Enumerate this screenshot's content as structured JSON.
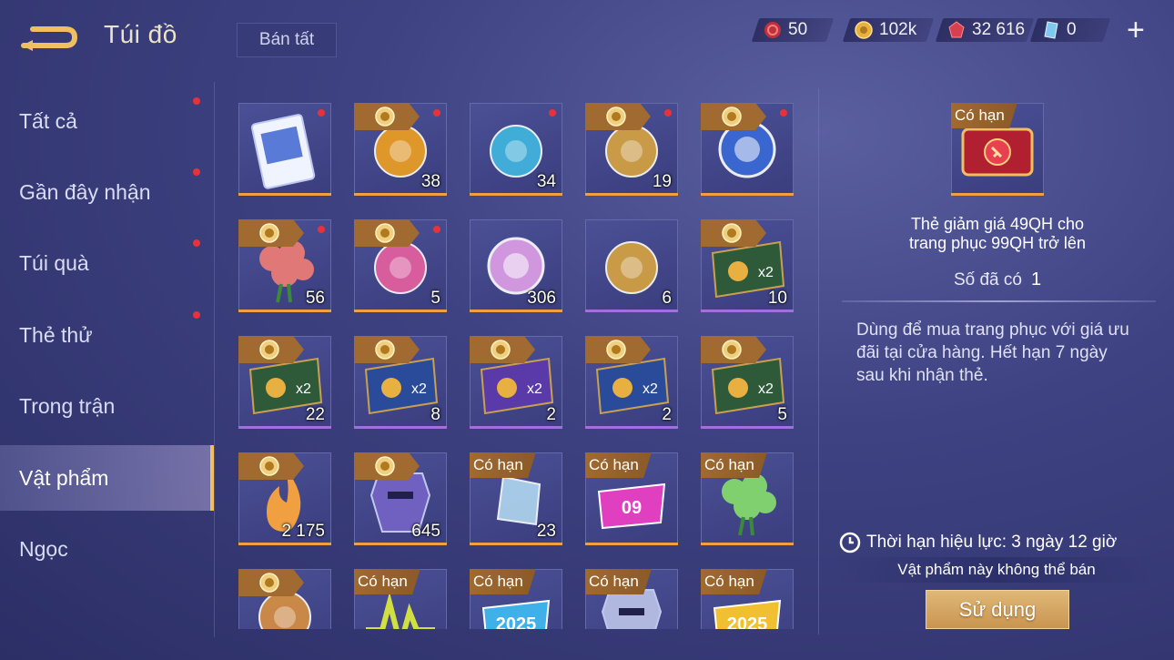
{
  "header": {
    "title": "Túi đồ",
    "sell_all_label": "Bán tất",
    "currencies": [
      {
        "icon": "red-token-icon",
        "value": "50"
      },
      {
        "icon": "gold-coin-icon",
        "value": "102k"
      },
      {
        "icon": "red-gem-icon",
        "value": "32 616"
      },
      {
        "icon": "blue-crystal-icon",
        "value": "0"
      }
    ],
    "add_label": "+"
  },
  "sidebar": {
    "items": [
      {
        "label": "Tất cả",
        "dot": true
      },
      {
        "label": "Gần đây nhận",
        "dot": true
      },
      {
        "label": "Túi quà",
        "dot": true
      },
      {
        "label": "Thẻ thử",
        "dot": true
      },
      {
        "label": "Trong trận",
        "dot": false
      },
      {
        "label": "Vật phẩm",
        "dot": false,
        "active": true
      },
      {
        "label": "Ngọc",
        "dot": false
      }
    ]
  },
  "grid": {
    "items": [
      {
        "name": "voucher-card",
        "tag": "",
        "count": "",
        "dot": true,
        "color": "#5a7ad8",
        "bar": "#f0a040"
      },
      {
        "name": "coin-drink",
        "tag": "coin",
        "count": "38",
        "dot": true,
        "color": "#f0a020",
        "bar": "#f0a040"
      },
      {
        "name": "hero-shard",
        "tag": "",
        "count": "34",
        "dot": true,
        "color": "#40b8e0",
        "bar": "#f0a040"
      },
      {
        "name": "gold-trophy",
        "tag": "coin",
        "count": "19",
        "dot": true,
        "color": "#d8a440",
        "bar": "#f0a040"
      },
      {
        "name": "blue-emblem",
        "tag": "coin",
        "count": "",
        "dot": true,
        "color": "#3a6ad8",
        "bar": "#f0a040"
      },
      {
        "name": "rose-bouquet",
        "tag": "coin",
        "count": "56",
        "dot": true,
        "color": "#e07878",
        "bar": "#f0a040"
      },
      {
        "name": "birthday-cake",
        "tag": "coin",
        "count": "5",
        "dot": true,
        "color": "#e860a0",
        "bar": "#f0a040"
      },
      {
        "name": "crystal-orb",
        "tag": "",
        "count": "306",
        "dot": false,
        "color": "#e0a0e8",
        "bar": "#f0a040"
      },
      {
        "name": "gold-trumpet",
        "tag": "",
        "count": "6",
        "dot": false,
        "color": "#d8a440",
        "bar": "#a070e0"
      },
      {
        "name": "gold-card-x2",
        "tag": "coin",
        "count": "10",
        "dot": false,
        "color": "#2e5a3a",
        "bar": "#a070e0"
      },
      {
        "name": "gold-card-x2",
        "tag": "coin",
        "count": "22",
        "dot": false,
        "color": "#2e5a3a",
        "bar": "#a070e0"
      },
      {
        "name": "exp-card-x2",
        "tag": "coin",
        "count": "8",
        "dot": false,
        "color": "#2a4a9a",
        "bar": "#a070e0"
      },
      {
        "name": "skin-card",
        "tag": "coin",
        "count": "2",
        "dot": false,
        "color": "#5a3aa8",
        "bar": "#a070e0"
      },
      {
        "name": "exp-card-x2",
        "tag": "coin",
        "count": "2",
        "dot": false,
        "color": "#2a4a9a",
        "bar": "#a070e0"
      },
      {
        "name": "gold-card-x2",
        "tag": "coin",
        "count": "5",
        "dot": false,
        "color": "#2e5a3a",
        "bar": "#a070e0"
      },
      {
        "name": "flame",
        "tag": "coin",
        "count": "2 175",
        "dot": false,
        "color": "#f0a040",
        "bar": "#f0a040"
      },
      {
        "name": "knight-helmet",
        "tag": "coin",
        "count": "645",
        "dot": false,
        "color": "#7060c0",
        "bar": "#f0a040"
      },
      {
        "name": "prism-crystal",
        "tag": "Có hạn",
        "count": "23",
        "dot": false,
        "color": "#b0d8f0",
        "bar": "#f0a040"
      },
      {
        "name": "number-badge",
        "tag": "Có hạn",
        "count": "",
        "dot": false,
        "color": "#e040c0",
        "bar": "#f0a040",
        "label": "09"
      },
      {
        "name": "flower-bunch",
        "tag": "Có hạn",
        "count": "",
        "dot": false,
        "color": "#80d070",
        "bar": "#f0a040"
      },
      {
        "name": "gold-chest",
        "tag": "coin",
        "count": "",
        "dot": false,
        "color": "#d89040",
        "bar": "#f0a040"
      },
      {
        "name": "pulse-effect",
        "tag": "Có hạn",
        "count": "",
        "dot": false,
        "color": "#d0e040",
        "bar": "#f0a040"
      },
      {
        "name": "year-badge",
        "tag": "Có hạn",
        "count": "",
        "dot": false,
        "color": "#40b0e8",
        "bar": "#f0a040",
        "label": "2025"
      },
      {
        "name": "silver-crest",
        "tag": "Có hạn",
        "count": "",
        "dot": false,
        "color": "#b0b8e0",
        "bar": "#f0a040"
      },
      {
        "name": "year-badge-gold",
        "tag": "Có hạn",
        "count": "",
        "dot": false,
        "color": "#f0c030",
        "bar": "#f0a040",
        "label": "2025"
      }
    ]
  },
  "detail": {
    "tag": "Có hạn",
    "name_line1": "Thẻ giảm giá 49QH cho",
    "name_line2": "trang phục 99QH trở lên",
    "owned_label": "Số đã có",
    "owned_value": "1",
    "description": "Dùng để mua trang phục với giá ưu đãi tại cửa hàng. Hết hạn 7 ngày sau khi nhận thẻ.",
    "validity": "Thời hạn hiệu lực: 3 ngày 12 giờ",
    "no_sell": "Vật phẩm này không thể bán",
    "use_label": "Sử dụng"
  }
}
